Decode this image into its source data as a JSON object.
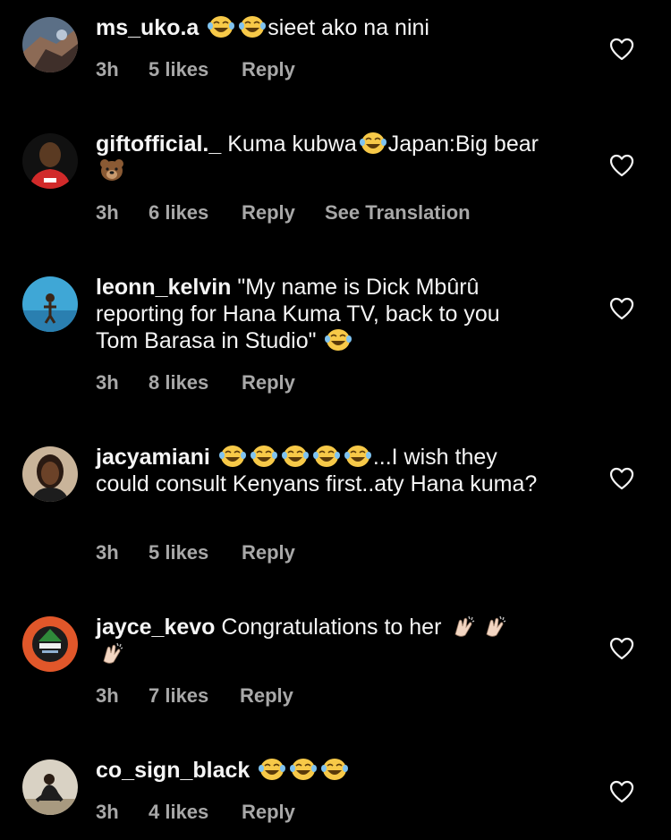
{
  "colors": {
    "background": "#000000",
    "text": "#f5f5f5",
    "meta_text": "#a8a8a8"
  },
  "comments": [
    {
      "username": "ms_uko.a",
      "parts": [
        "",
        "",
        "sieet ako na nini"
      ],
      "emoji_names": [
        "laughing-tears-emoji",
        "laughing-tears-emoji"
      ],
      "time": "3h",
      "likes": "5 likes",
      "reply": "Reply"
    },
    {
      "username": "giftofficial._",
      "parts": [
        "Kuma kubwa",
        "Japan:Big bear"
      ],
      "emoji_names": [
        "laughing-tears-emoji",
        "bear-face-emoji"
      ],
      "time": "3h",
      "likes": "6 likes",
      "reply": "Reply",
      "translate": "See Translation"
    },
    {
      "username": "leonn_kelvin",
      "parts": [
        "\"My name is Dick Mbûrû reporting for Hana Kuma TV, back to you Tom Barasa in Studio\""
      ],
      "emoji_names": [
        "laughing-tears-emoji"
      ],
      "time": "3h",
      "likes": "8 likes",
      "reply": "Reply"
    },
    {
      "username": "jacyamiani",
      "parts": [
        "...I wish they could consult Kenyans first..aty Hana kuma?"
      ],
      "emoji_names": [
        "laughing-tears-emoji",
        "laughing-tears-emoji",
        "laughing-tears-emoji",
        "laughing-tears-emoji",
        "laughing-tears-emoji"
      ],
      "time": "3h",
      "likes": "5 likes",
      "reply": "Reply"
    },
    {
      "username": "jayce_kevo",
      "parts": [
        "Congratulations to her"
      ],
      "emoji_names": [
        "clapping-hands-emoji",
        "clapping-hands-emoji",
        "clapping-hands-emoji"
      ],
      "time": "3h",
      "likes": "7 likes",
      "reply": "Reply"
    },
    {
      "username": "co_sign_black",
      "parts": [
        ""
      ],
      "emoji_names": [
        "laughing-tears-emoji",
        "laughing-tears-emoji",
        "laughing-tears-emoji"
      ],
      "time": "3h",
      "likes": "4 likes",
      "reply": "Reply"
    }
  ],
  "icons": {
    "like": "heart-outline-icon"
  }
}
